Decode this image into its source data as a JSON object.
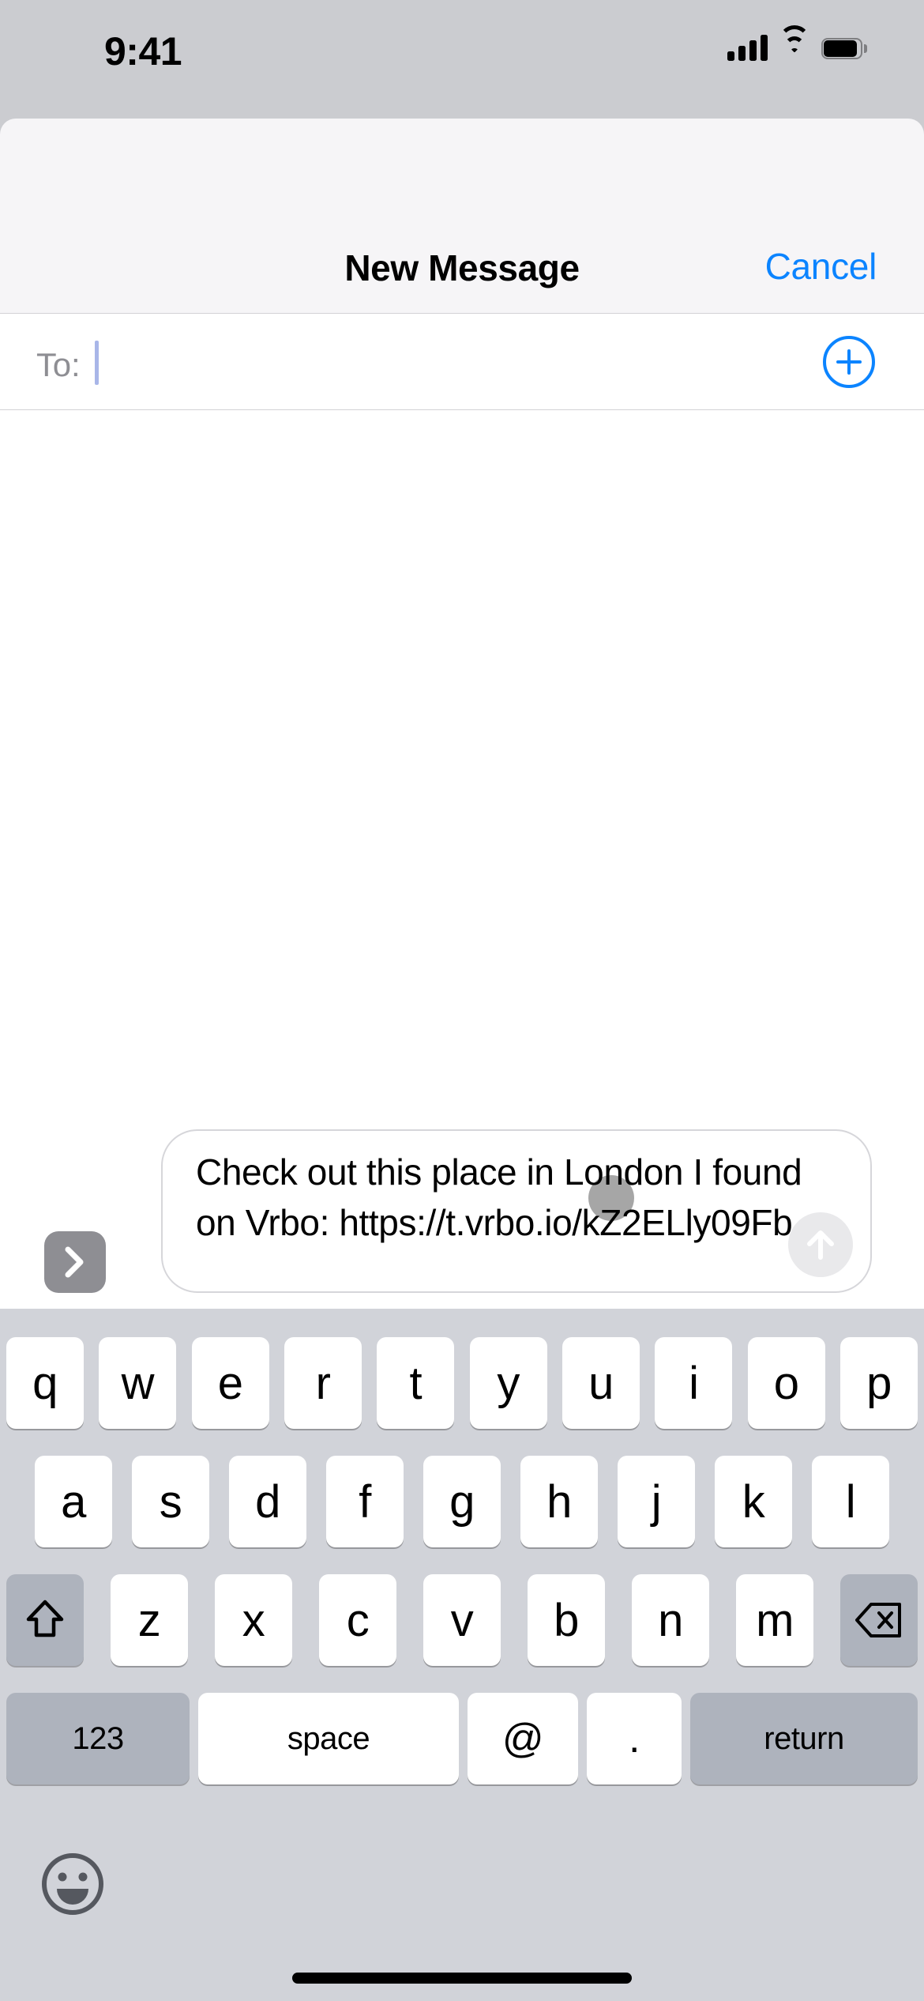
{
  "status_bar": {
    "time": "9:41",
    "cellular_icon": "cellular-bars-icon",
    "wifi_icon": "wifi-icon",
    "battery_icon": "battery-full-icon"
  },
  "nav": {
    "title": "New Message",
    "cancel_label": "Cancel"
  },
  "recipients": {
    "to_label": "To:",
    "to_value": "",
    "to_placeholder": "",
    "add_contact_icon": "plus-circle-icon"
  },
  "compose": {
    "message_text": "Check out this place in London I found on Vrbo: https://t.vrbo.io/kZ2ELly09Fb",
    "apps_expand_icon": "chevron-right-icon",
    "send_icon": "arrow-up-icon",
    "send_enabled": "false",
    "touch_indicator": "tap-indicator"
  },
  "keyboard": {
    "row1": [
      "q",
      "w",
      "e",
      "r",
      "t",
      "y",
      "u",
      "i",
      "o",
      "p"
    ],
    "row2": [
      "a",
      "s",
      "d",
      "f",
      "g",
      "h",
      "j",
      "k",
      "l"
    ],
    "row3_letters": [
      "z",
      "x",
      "c",
      "v",
      "b",
      "n",
      "m"
    ],
    "shift_icon": "shift-arrow-icon",
    "delete_icon": "backspace-icon",
    "numbers_label": "123",
    "space_label": "space",
    "at_label": "@",
    "period_label": ".",
    "return_label": "return",
    "emoji_icon": "smiley-face-icon"
  },
  "colors": {
    "accent_blue": "#0b84ff",
    "status_bg": "#cbccd0",
    "nav_bg": "#f6f5f7",
    "keyboard_bg": "#d1d3d9",
    "key_white": "#ffffff",
    "key_dark": "#aeb3bd",
    "placeholder_gray": "#8e8e93"
  },
  "home_indicator": "home-indicator-bar"
}
